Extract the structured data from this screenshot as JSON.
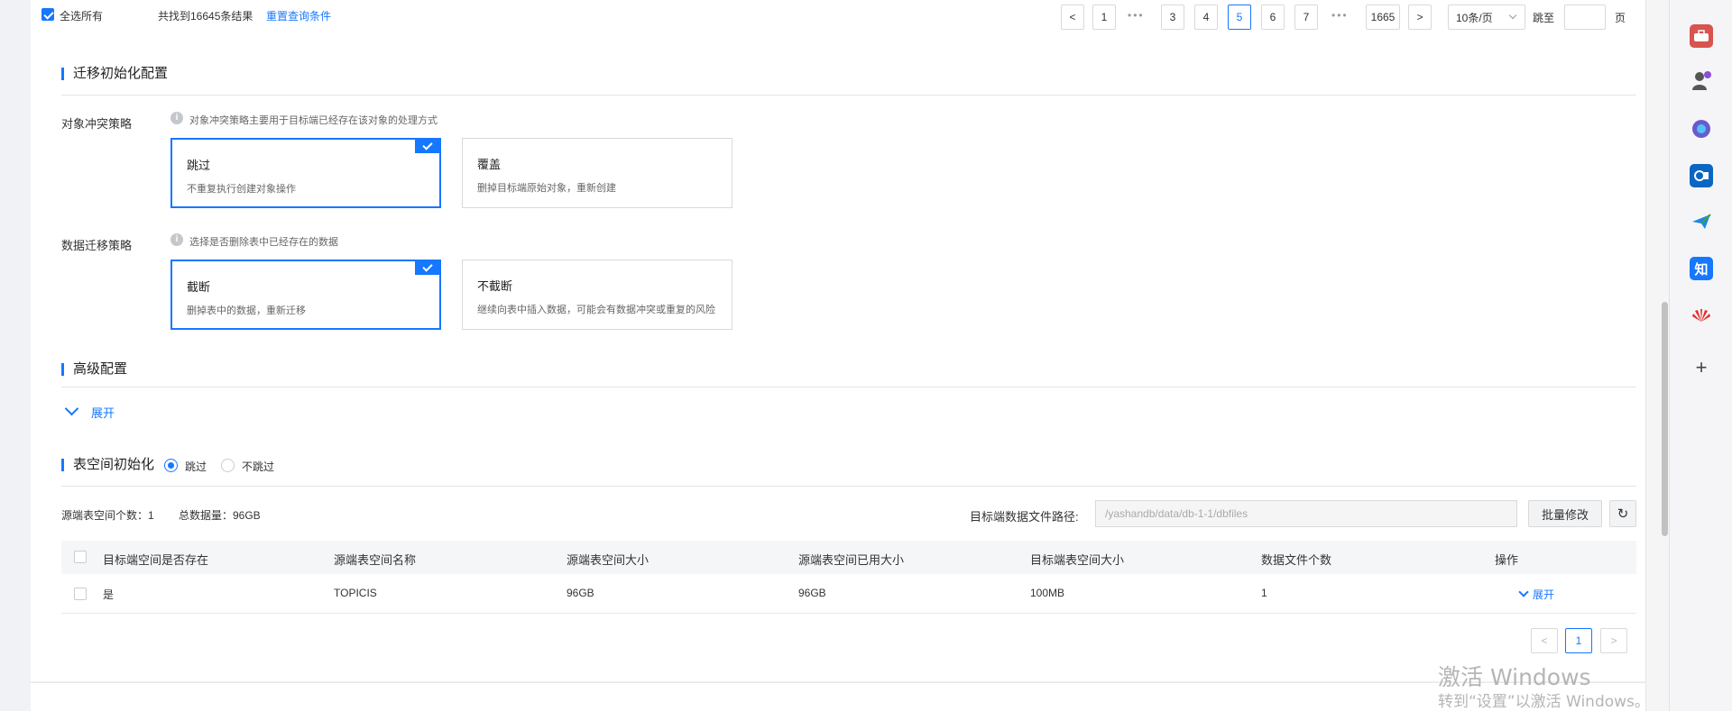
{
  "toolbar": {
    "select_all_label": "全选所有",
    "result_text": "共找到16645条结果",
    "reset_link": "重置查询条件"
  },
  "pagination": {
    "prev": "<",
    "next": ">",
    "pages": [
      "1",
      "3",
      "4",
      "5",
      "6",
      "7",
      "1665"
    ],
    "current": "5",
    "page_size": "10条/页",
    "jump_label": "跳至",
    "page_unit": "页",
    "jump_value": ""
  },
  "migration_init": {
    "title": "迁移初始化配置",
    "conflict": {
      "label": "对象冲突策略",
      "hint": "对象冲突策略主要用于目标端已经存在该对象的处理方式",
      "options": [
        {
          "title": "跳过",
          "desc": "不重复执行创建对象操作",
          "selected": true
        },
        {
          "title": "覆盖",
          "desc": "删掉目标端原始对象，重新创建",
          "selected": false
        }
      ]
    },
    "data": {
      "label": "数据迁移策略",
      "hint": "选择是否删除表中已经存在的数据",
      "options": [
        {
          "title": "截断",
          "desc": "删掉表中的数据，重新迁移",
          "selected": true
        },
        {
          "title": "不截断",
          "desc": "继续向表中插入数据，可能会有数据冲突或重复的风险",
          "selected": false
        }
      ]
    }
  },
  "advanced": {
    "title": "高级配置",
    "expand_label": "展开"
  },
  "tablespace": {
    "title": "表空间初始化",
    "radio_skip": "跳过",
    "radio_noskip": "不跳过",
    "selected": "跳过",
    "source_count": "源端表空间个数：1",
    "total_data": "总数据量：96GB",
    "path_label": "目标端数据文件路径:",
    "path_value": "/yashandb/data/db-1-1/dbfiles",
    "batch_button": "批量修改",
    "columns": [
      "目标端空间是否存在",
      "源端表空间名称",
      "源端表空间大小",
      "源端表空间已用大小",
      "目标端表空间大小",
      "数据文件个数",
      "操作"
    ],
    "rows": [
      {
        "exists": "是",
        "name": "TOPICIS",
        "size": "96GB",
        "used": "96GB",
        "target_size": "100MB",
        "files": "1",
        "action": "展开"
      }
    ],
    "pager": {
      "prev": "<",
      "page": "1",
      "next": ">"
    }
  },
  "watermark": {
    "line1": "激活 Windows",
    "line2": "转到“设置”以激活 Windows。"
  },
  "rail": {
    "icons": [
      "toolbox-icon",
      "user-icon",
      "copilot-icon",
      "outlook-icon",
      "send-icon",
      "zhihu-icon",
      "huawei-icon",
      "add-icon"
    ],
    "zhihu_text": "知"
  },
  "colors": {
    "accent": "#1677ff",
    "rail_bg": "#f5f5f7"
  }
}
